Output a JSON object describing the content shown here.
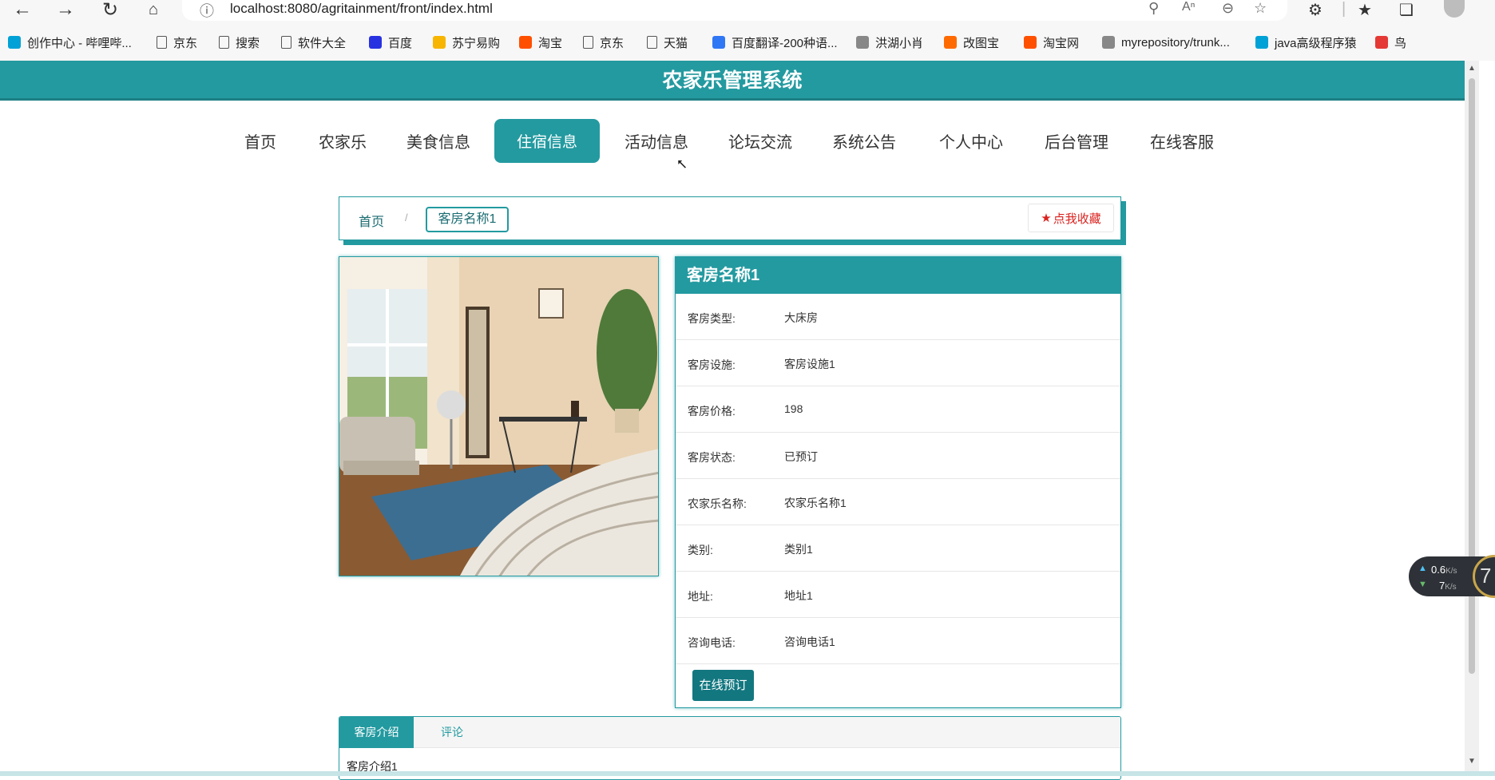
{
  "browser": {
    "url": "localhost:8080/agritainment/front/index.html",
    "bookmarks": [
      {
        "label": "创作中心 - 哔哩哔...",
        "icon": "bilibili-icon",
        "color": "#00a1d6"
      },
      {
        "label": "京东",
        "icon": "page-icon"
      },
      {
        "label": "搜索",
        "icon": "page-icon"
      },
      {
        "label": "软件大全",
        "icon": "page-icon"
      },
      {
        "label": "百度",
        "icon": "baidu-icon",
        "color": "#2932e1"
      },
      {
        "label": "苏宁易购",
        "icon": "suning-icon",
        "color": "#f7b500"
      },
      {
        "label": "淘宝",
        "icon": "taobao-icon",
        "color": "#ff5000"
      },
      {
        "label": "京东",
        "icon": "page-icon"
      },
      {
        "label": "天猫",
        "icon": "page-icon"
      },
      {
        "label": "百度翻译-200种语...",
        "icon": "baidu-translate-icon",
        "color": "#3077f5"
      },
      {
        "label": "洪湖小肖",
        "icon": "bird-icon"
      },
      {
        "label": "改图宝",
        "icon": "gaitubao-icon",
        "color": "#ff6a00"
      },
      {
        "label": "淘宝网",
        "icon": "taobao-icon",
        "color": "#ff5000"
      },
      {
        "label": "myrepository/trunk...",
        "icon": "chrome-icon"
      },
      {
        "label": "java高级程序猿",
        "icon": "bilibili-icon",
        "color": "#00a1d6"
      },
      {
        "label": "鸟",
        "icon": "bird-icon",
        "color": "#e53935"
      }
    ]
  },
  "site": {
    "title": "农家乐管理系统",
    "accent_color": "#239aa0",
    "menu": [
      {
        "label": "首页",
        "active": false
      },
      {
        "label": "农家乐",
        "active": false
      },
      {
        "label": "美食信息",
        "active": false
      },
      {
        "label": "住宿信息",
        "active": true
      },
      {
        "label": "活动信息",
        "active": false
      },
      {
        "label": "论坛交流",
        "active": false
      },
      {
        "label": "系统公告",
        "active": false
      },
      {
        "label": "个人中心",
        "active": false
      },
      {
        "label": "后台管理",
        "active": false
      },
      {
        "label": "在线客服",
        "active": false
      }
    ]
  },
  "breadcrumb": {
    "home": "首页",
    "separator": "/",
    "current": "客房名称1",
    "favorite_label": "点我收藏"
  },
  "room": {
    "title": "客房名称1",
    "fields": [
      {
        "label": "客房类型:",
        "value": "大床房"
      },
      {
        "label": "客房设施:",
        "value": "客房设施1"
      },
      {
        "label": "客房价格:",
        "value": "198"
      },
      {
        "label": "客房状态:",
        "value": "已预订"
      },
      {
        "label": "农家乐名称:",
        "value": "农家乐名称1"
      },
      {
        "label": "类别:",
        "value": "类别1"
      },
      {
        "label": "地址:",
        "value": "地址1"
      },
      {
        "label": "咨询电话:",
        "value": "咨询电话1"
      }
    ],
    "book_label": "在线预订"
  },
  "tabs": {
    "items": [
      "客房介绍",
      "评论"
    ],
    "content": "客房介绍1"
  },
  "speed_widget": {
    "up": "0.6",
    "down": "7",
    "unit": "K/s",
    "ring": "7"
  }
}
